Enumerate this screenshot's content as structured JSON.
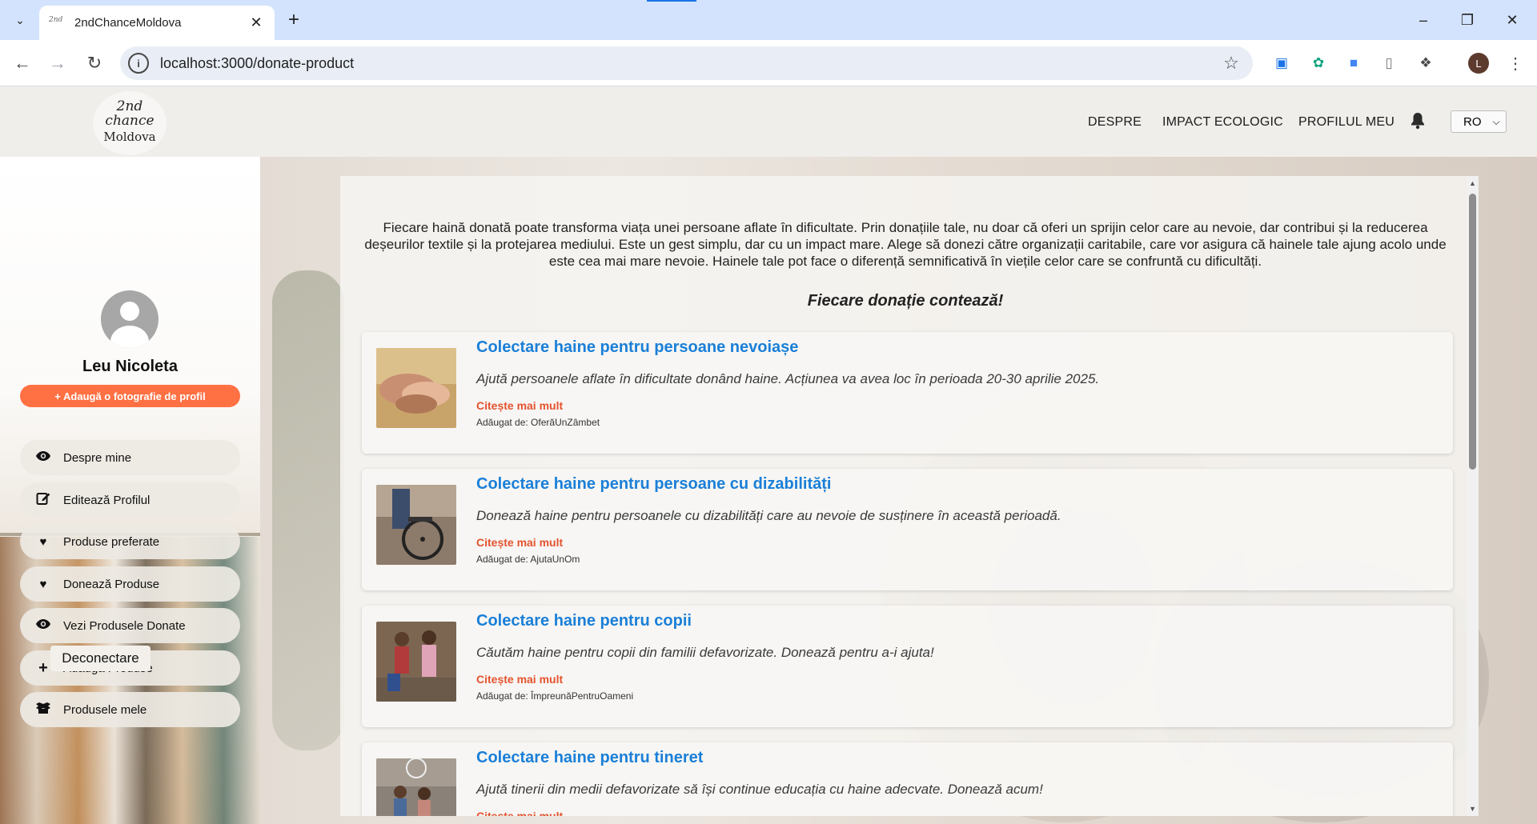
{
  "browser": {
    "tab_title": "2ndChanceMoldova",
    "url": "localhost:3000/donate-product",
    "profile_initial": "L"
  },
  "header": {
    "logo_line1": "2nd chance",
    "logo_line2": "Moldova",
    "nav": [
      "DESPRE",
      "IMPACT ECOLOGIC",
      "PROFILUL MEU"
    ],
    "language": "RO"
  },
  "sidebar": {
    "user_name": "Leu Nicoleta",
    "add_photo_label": "+ Adaugă o fotografie de profil",
    "items": [
      {
        "label": "Despre mine",
        "icon": "eye-icon"
      },
      {
        "label": "Editează Profilul",
        "icon": "edit-icon"
      },
      {
        "label": "Produse preferate",
        "icon": "heart-icon"
      },
      {
        "label": "Donează Produse",
        "icon": "heart-icon"
      },
      {
        "label": "Vezi Produsele Donate",
        "icon": "eye-icon"
      },
      {
        "label": "Adaugă Produse",
        "icon": "plus-icon"
      },
      {
        "label": "Produsele mele",
        "icon": "box-icon"
      }
    ],
    "logout_label": "Deconectare"
  },
  "main": {
    "intro": "Fiecare haină donată poate transforma viața unei persoane aflate în dificultate. Prin donațiile tale, nu doar că oferi un sprijin celor care au nevoie, dar contribui și la reducerea deșeurilor textile și la protejarea mediului. Este un gest simplu, dar cu un impact mare. Alege să donezi către organizații caritabile, care vor asigura că hainele tale ajung acolo unde este cea mai mare nevoie. Hainele tale pot face o diferență semnificativă în viețile celor care se confruntă cu dificultăți.",
    "tagline": "Fiecare donație contează!",
    "read_more_label": "Citește mai mult",
    "campaigns": [
      {
        "title": "Colectare haine pentru persoane nevoiașe",
        "description": "Ajută persoanele aflate în dificultate donând haine. Acțiunea va avea loc în perioada 20-30 aprilie 2025.",
        "author": "Adăugat de: OferăUnZâmbet"
      },
      {
        "title": "Colectare haine pentru persoane cu dizabilități",
        "description": "Donează haine pentru persoanele cu dizabilități care au nevoie de susținere în această perioadă.",
        "author": "Adăugat de: AjutaUnOm"
      },
      {
        "title": "Colectare haine pentru copii",
        "description": "Căutăm haine pentru copii din familii defavorizate. Donează pentru a-i ajuta!",
        "author": "Adăugat de: ÎmpreunăPentruOameni"
      },
      {
        "title": "Colectare haine pentru tineret",
        "description": "Ajută tinerii din medii defavorizate să își continue educația cu haine adecvate. Donează acum!",
        "author": ""
      }
    ]
  }
}
